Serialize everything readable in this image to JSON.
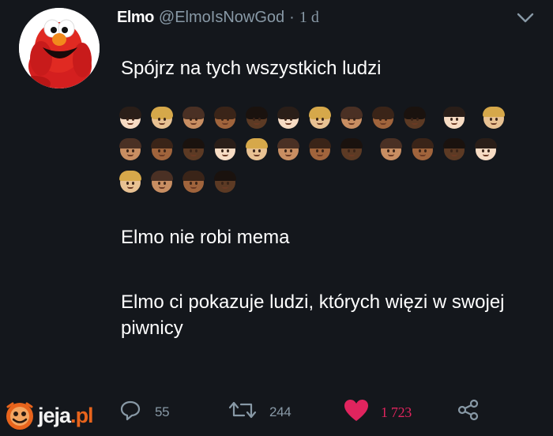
{
  "tweet": {
    "author_name": "Elmo",
    "author_handle": "@ElmoIsNowGod",
    "separator": "·",
    "timestamp": "1 d",
    "text_lines": [
      "Spójrz na tych wszystkich ludzi",
      "Elmo nie robi mema",
      "Elmo ci pokazuje ludzi, których więzi w swojej piwnicy"
    ],
    "emoji_rows": [
      [
        "woman-light",
        "woman-medium-light-blond",
        "woman-medium",
        "woman-medium-dark",
        "woman-dark",
        "woman-light",
        "woman-medium-light-blond",
        "woman-medium",
        "woman-medium-dark",
        "woman-dark",
        "man-light",
        "man-medium-light-blond"
      ],
      [
        "man-medium",
        "man-medium-dark",
        "man-dark",
        "man-light",
        "man-medium-light-blond",
        "man-medium",
        "man-medium-dark",
        "man-dark",
        "boy-medium",
        "boy-medium-dark",
        "boy-dark",
        "boy-light"
      ],
      [
        "boy-medium-light-blond",
        "boy-medium",
        "boy-medium-dark",
        "boy-dark"
      ]
    ]
  },
  "actions": {
    "reply_count": "55",
    "retweet_count": "244",
    "like_count": "1 723",
    "reply_icon": "reply-icon",
    "retweet_icon": "retweet-icon",
    "like_icon": "heart-icon",
    "share_icon": "share-icon",
    "like_color": "#e0245e"
  },
  "watermark": {
    "brand": "jeja",
    "dot": ".",
    "tld": "pl"
  },
  "colors": {
    "background": "#14171c",
    "muted": "#8899a6",
    "text": "#ffffff",
    "brand_accent": "#e8641c"
  }
}
